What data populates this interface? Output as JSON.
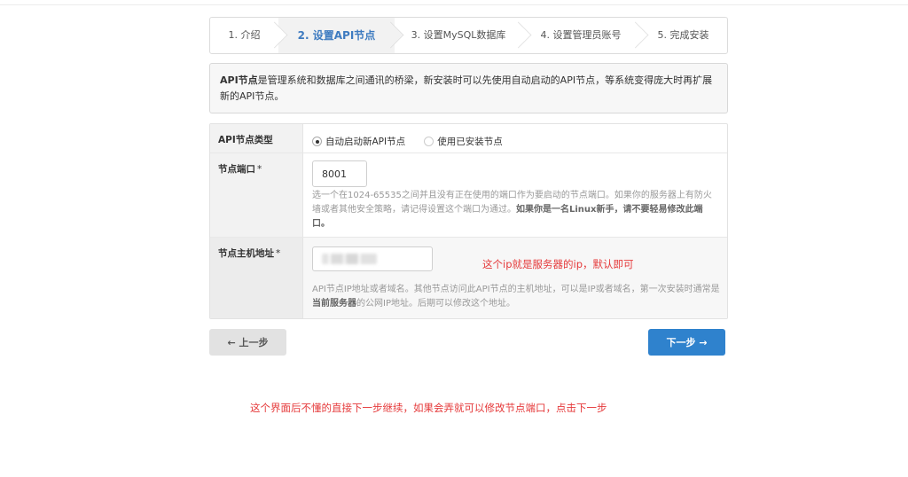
{
  "steps": [
    {
      "label": "1. 介绍",
      "active": false
    },
    {
      "label": "2. 设置API节点",
      "active": true
    },
    {
      "label": "3. 设置MySQL数据库",
      "active": false
    },
    {
      "label": "4. 设置管理员账号",
      "active": false
    },
    {
      "label": "5. 完成安装",
      "active": false
    }
  ],
  "info": {
    "bold": "API节点",
    "text": "是管理系统和数据库之间通讯的桥梁，新安装时可以先使用自动启动的API节点，等系统变得庞大时再扩展新的API节点。"
  },
  "form": {
    "type": {
      "label": "API节点类型",
      "option_auto": "自动启动新API节点",
      "option_installed": "使用已安装节点",
      "selected": "option_auto"
    },
    "port": {
      "label": "节点端口",
      "required_mark": "*",
      "value": "8001",
      "help_pre": "选一个在1024-65535之间并且没有正在使用的端口作为要启动的节点端口。如果你的服务器上有防火墙或者其他安全策略，请记得设置这个端口为通过。",
      "help_bold": "如果你是一名Linux新手，请不要轻易修改此端口。"
    },
    "host": {
      "label": "节点主机地址",
      "required_mark": "*",
      "help_pre": "API节点IP地址或者域名。其他节点访问此API节点的主机地址，可以是IP或者域名，第一次安装时通常是",
      "help_bold": "当前服务器",
      "help_post": "的公网IP地址。后期可以修改这个地址。"
    }
  },
  "annotations": {
    "host_note": "这个ip就是服务器的ip，默认即可",
    "bottom_note": "这个界面后不懂的直接下一步继续，如果会弄就可以修改节点端口，点击下一步"
  },
  "buttons": {
    "prev_label": "上一步",
    "prev_icon": "←",
    "next_label": "下一步",
    "next_icon": "→"
  },
  "colors": {
    "accent": "#2f82cd",
    "active_step": "#3e7bc0",
    "annotation": "#e5393a"
  }
}
